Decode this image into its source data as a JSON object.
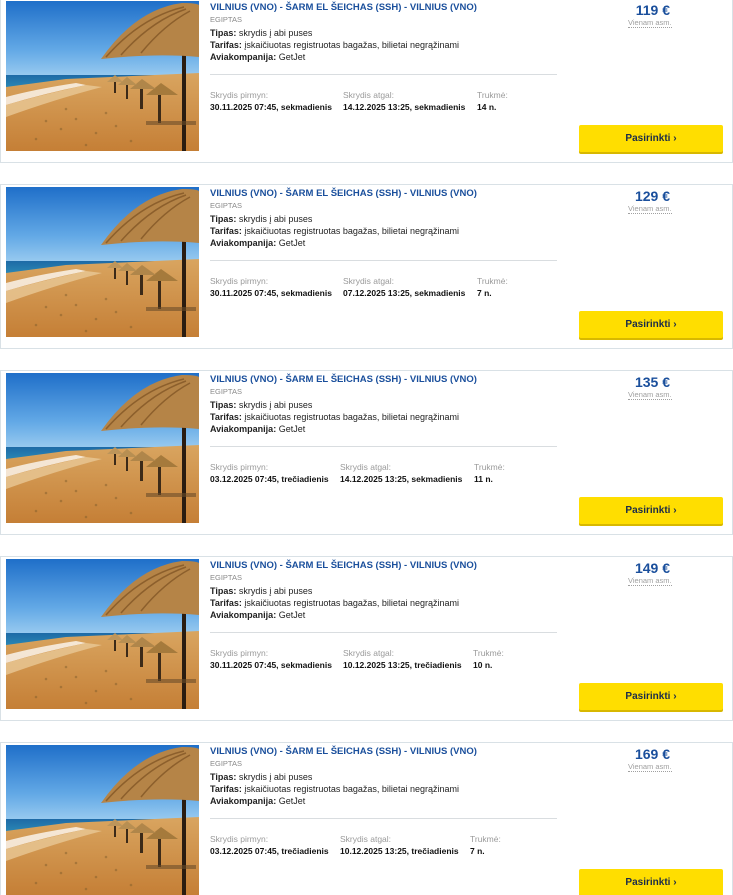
{
  "labels": {
    "type_label": "Tipas:",
    "fare_label": "Tarifas:",
    "airline_label": "Aviakompanija:",
    "depart_label": "Skrydis pirmyn:",
    "return_label": "Skrydis atgal:",
    "duration_label": "Trukmė:",
    "per_person": "Vienam asm.",
    "select_button": "Pasirinkti ›"
  },
  "offers": [
    {
      "route": "VILNIUS (VNO) - ŠARM EL ŠEICHAS (SSH) - VILNIUS (VNO)",
      "country": "EGIPTAS",
      "type": "skrydis į abi puses",
      "fare": "įskaičiuotas registruotas bagažas, bilietai negrąžinami",
      "airline": "GetJet",
      "depart": "30.11.2025 07:45, sekmadienis",
      "return": "14.12.2025 13:25, sekmadienis",
      "duration": "14 n.",
      "price": "119 €"
    },
    {
      "route": "VILNIUS (VNO) - ŠARM EL ŠEICHAS (SSH) - VILNIUS (VNO)",
      "country": "EGIPTAS",
      "type": "skrydis į abi puses",
      "fare": "įskaičiuotas registruotas bagažas, bilietai negrąžinami",
      "airline": "GetJet",
      "depart": "30.11.2025 07:45, sekmadienis",
      "return": "07.12.2025 13:25, sekmadienis",
      "duration": "7 n.",
      "price": "129 €"
    },
    {
      "route": "VILNIUS (VNO) - ŠARM EL ŠEICHAS (SSH) - VILNIUS (VNO)",
      "country": "EGIPTAS",
      "type": "skrydis į abi puses",
      "fare": "įskaičiuotas registruotas bagažas, bilietai negrąžinami",
      "airline": "GetJet",
      "depart": "03.12.2025 07:45, trečiadienis",
      "return": "14.12.2025 13:25, sekmadienis",
      "duration": "11 n.",
      "price": "135 €"
    },
    {
      "route": "VILNIUS (VNO) - ŠARM EL ŠEICHAS (SSH) - VILNIUS (VNO)",
      "country": "EGIPTAS",
      "type": "skrydis į abi puses",
      "fare": "įskaičiuotas registruotas bagažas, bilietai negrąžinami",
      "airline": "GetJet",
      "depart": "30.11.2025 07:45, sekmadienis",
      "return": "10.12.2025 13:25, trečiadienis",
      "duration": "10 n.",
      "price": "149 €"
    },
    {
      "route": "VILNIUS (VNO) - ŠARM EL ŠEICHAS (SSH) - VILNIUS (VNO)",
      "country": "EGIPTAS",
      "type": "skrydis į abi puses",
      "fare": "įskaičiuotas registruotas bagažas, bilietai negrąžinami",
      "airline": "GetJet",
      "depart": "03.12.2025 07:45, trečiadienis",
      "return": "10.12.2025 13:25, trečiadienis",
      "duration": "7 n.",
      "price": "169 €"
    }
  ]
}
